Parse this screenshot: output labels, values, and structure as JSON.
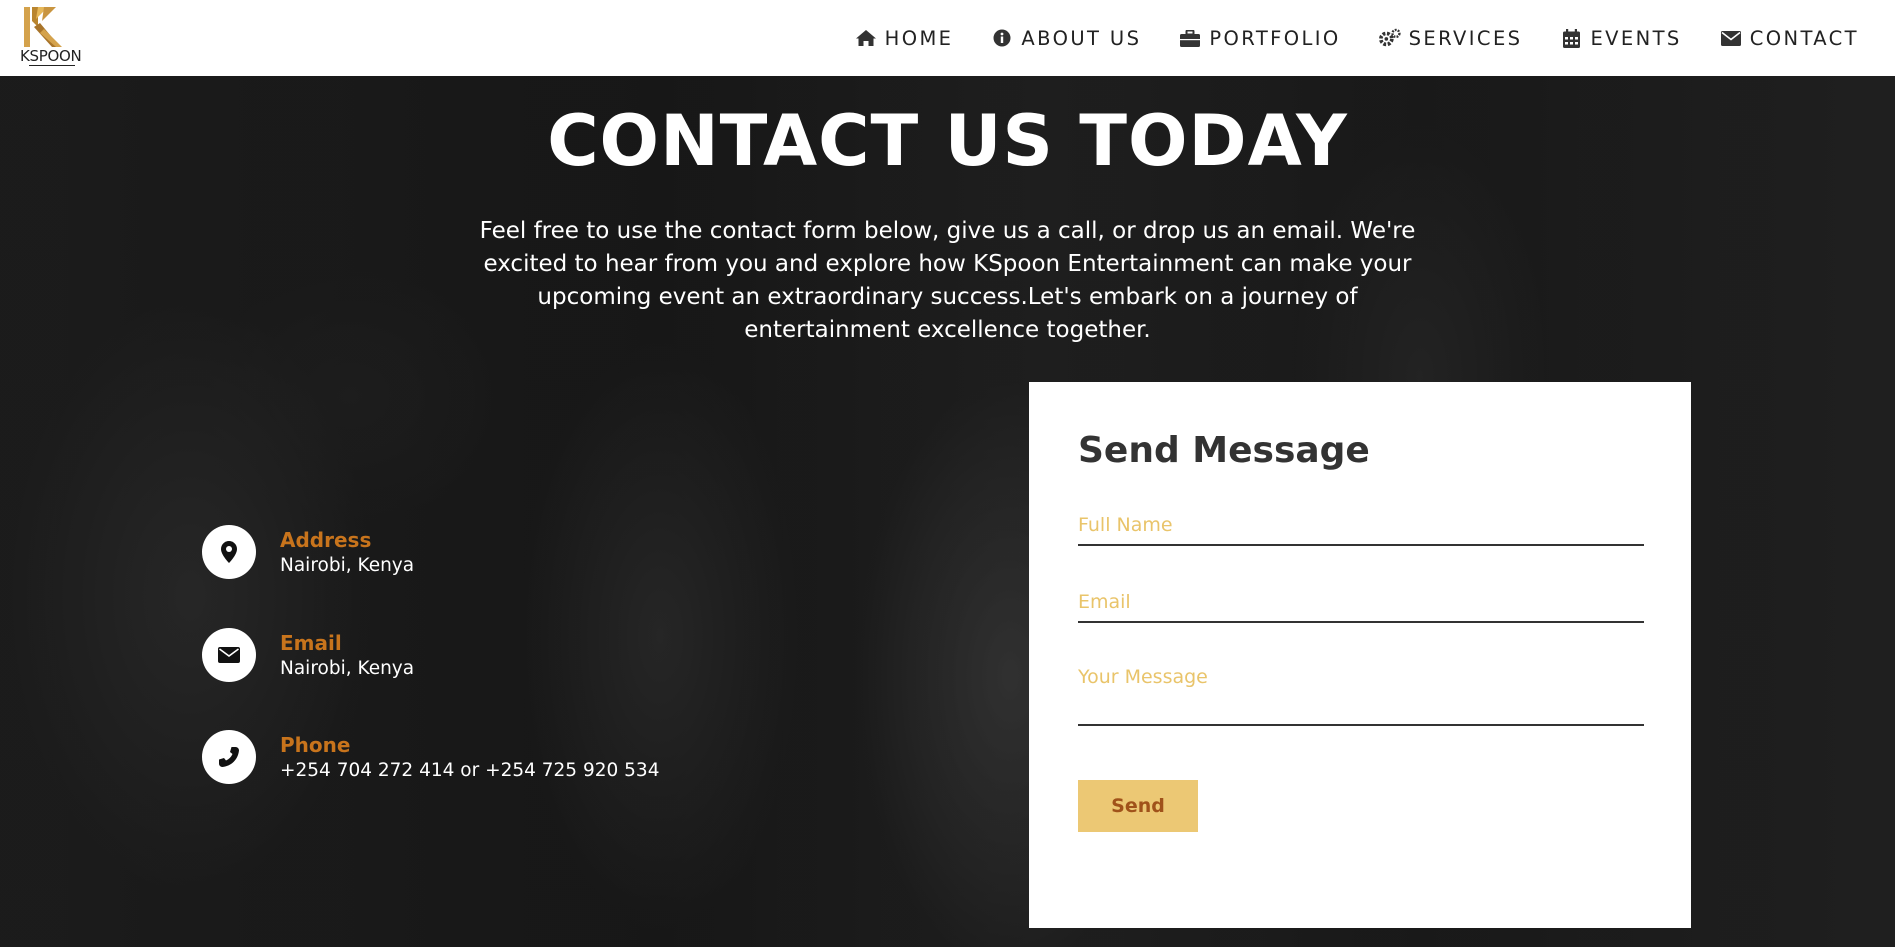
{
  "brand": {
    "logo_text": "KSPOON"
  },
  "nav": {
    "items": [
      {
        "label": "HOME",
        "icon": "home-icon"
      },
      {
        "label": "ABOUT US",
        "icon": "info-circle-icon"
      },
      {
        "label": "PORTFOLIO",
        "icon": "briefcase-icon"
      },
      {
        "label": "SERVICES",
        "icon": "gears-icon"
      },
      {
        "label": "EVENTS",
        "icon": "calendar-icon"
      },
      {
        "label": "CONTACT",
        "icon": "envelope-icon"
      }
    ]
  },
  "hero": {
    "title": "CONTACT US TODAY",
    "description": "Feel free to use the contact form below, give us a call, or drop us an email. We're excited to hear from you and explore how KSpoon Entertainment can make your upcoming event an extraordinary success.Let's embark on a journey of entertainment excellence together."
  },
  "contact_info": {
    "address": {
      "label": "Address",
      "value": "Nairobi, Kenya",
      "icon": "map-pin-icon"
    },
    "email": {
      "label": "Email",
      "value": "Nairobi, Kenya",
      "icon": "envelope-icon"
    },
    "phone": {
      "label": "Phone",
      "value": "+254 704 272 414 or +254 725 920 534",
      "icon": "phone-icon"
    }
  },
  "form": {
    "title": "Send Message",
    "full_name_placeholder": "Full Name",
    "email_placeholder": "Email",
    "message_placeholder": "Your Message",
    "send_label": "Send"
  },
  "colors": {
    "accent_orange": "#c8741c",
    "button_bg": "#ecc874",
    "button_text": "#a0521a",
    "placeholder": "#e9c46a"
  }
}
